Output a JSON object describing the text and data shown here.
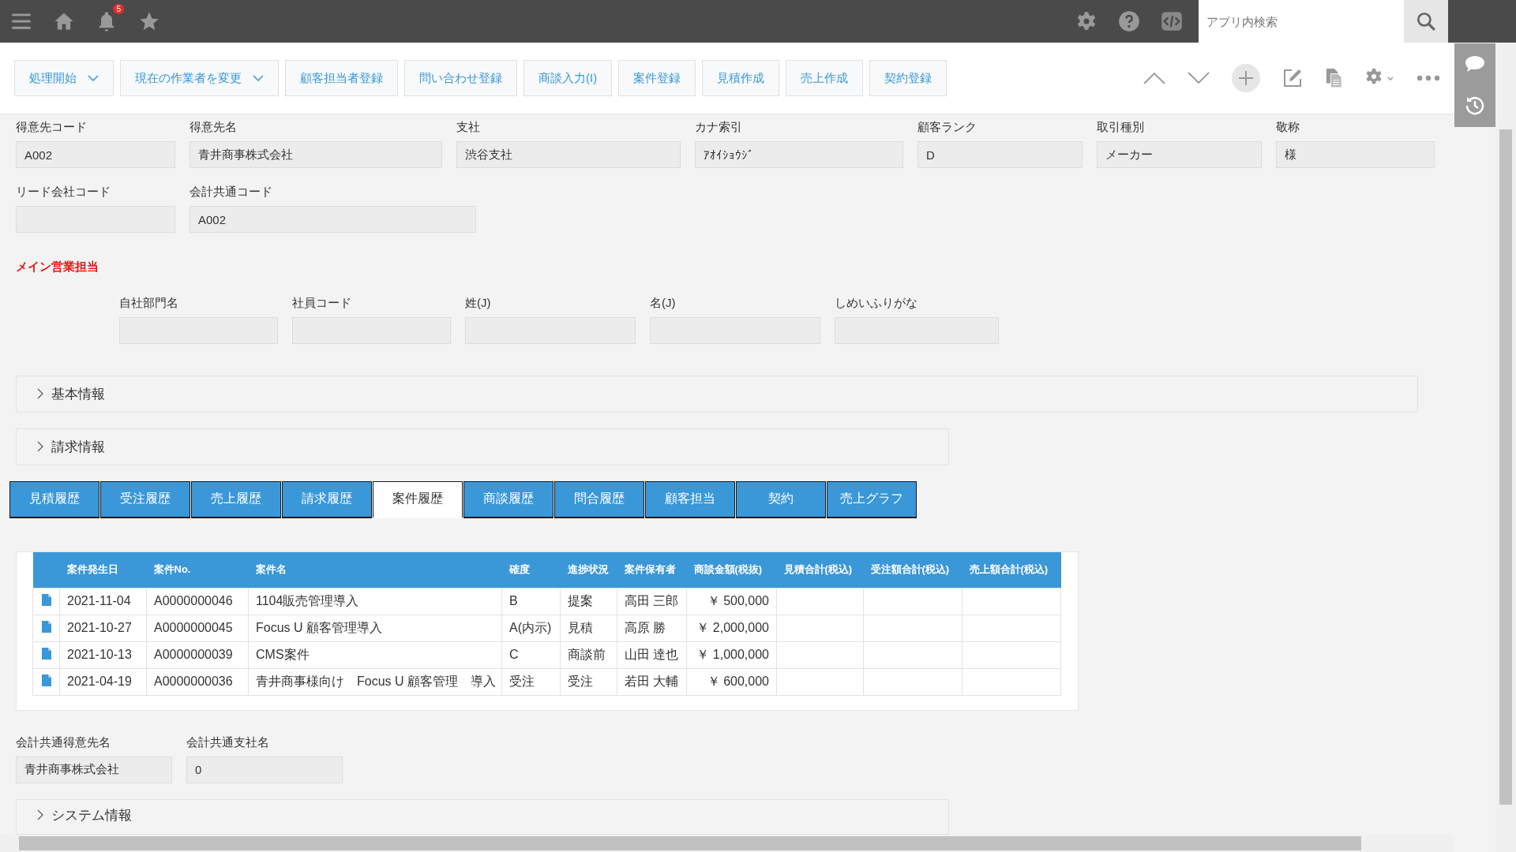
{
  "top_bar": {
    "notification_count": "5",
    "search": {
      "placeholder": "アプリ内検索"
    }
  },
  "toolbar": {
    "buttons": [
      {
        "label": "処理開始",
        "has_menu": true
      },
      {
        "label": "現在の作業者を変更",
        "has_menu": true
      },
      {
        "label": "顧客担当者登録",
        "has_menu": false
      },
      {
        "label": "問い合わせ登録",
        "has_menu": false
      },
      {
        "label": "商談入力(I)",
        "has_menu": false
      },
      {
        "label": "案件登録",
        "has_menu": false
      },
      {
        "label": "見積作成",
        "has_menu": false
      },
      {
        "label": "売上作成",
        "has_menu": false
      },
      {
        "label": "契約登録",
        "has_menu": false
      }
    ]
  },
  "field_rows": [
    [
      {
        "label": "得意先コード",
        "value": "A002"
      },
      {
        "label": "得意先名",
        "value": "青井商事株式会社"
      },
      {
        "label": "支社",
        "value": "渋谷支社"
      },
      {
        "label": "カナ索引",
        "value": "ｱｵｲｼｮｳｼﾞ"
      },
      {
        "label": "顧客ランク",
        "value": "D"
      },
      {
        "label": "取引種別",
        "value": "メーカー"
      },
      {
        "label": "敬称",
        "value": "様"
      }
    ],
    [
      {
        "label": "リード会社コード"
      },
      {
        "label": "会計共通コード",
        "value": "A002"
      }
    ]
  ],
  "main_sales": {
    "title": "メイン営業担当",
    "fields": [
      {
        "label": "自社部門名"
      },
      {
        "label": "社員コード"
      },
      {
        "label": "姓(J)"
      },
      {
        "label": "名(J)"
      },
      {
        "label": "しめいふりがな"
      }
    ]
  },
  "sections": [
    {
      "title": "基本情報",
      "expanded": false
    },
    {
      "title": "請求情報",
      "expanded": false
    }
  ],
  "tabs": [
    {
      "label": "見積履歴",
      "selected": false
    },
    {
      "label": "受注履歴",
      "selected": false
    },
    {
      "label": "売上履歴",
      "selected": false
    },
    {
      "label": "請求履歴",
      "selected": false
    },
    {
      "label": "案件履歴",
      "selected": true
    },
    {
      "label": "商談履歴",
      "selected": false
    },
    {
      "label": "問合履歴",
      "selected": false
    },
    {
      "label": "顧客担当",
      "selected": false
    },
    {
      "label": "契約",
      "selected": false
    },
    {
      "label": "売上グラフ",
      "selected": false
    }
  ],
  "table": {
    "columns": [
      "案件発生日",
      "案件No.",
      "案件名",
      "確度",
      "進捗状況",
      "案件保有者",
      "商談金額(税抜)",
      "見積合計(税込)",
      "受注額合計(税込)",
      "売上額合計(税込)"
    ],
    "rows": [
      [
        "2021-11-04",
        "A0000000046",
        "1104販売管理導入",
        "B",
        "提案",
        "高田 三郎",
        "￥ 500,000"
      ],
      [
        "2021-10-27",
        "A0000000045",
        "Focus U 顧客管理導入",
        "A(内示)",
        "見積",
        "高原 勝",
        "￥ 2,000,000"
      ],
      [
        "2021-10-13",
        "A0000000039",
        "CMS案件",
        "C",
        "商談前",
        "山田 達也",
        "￥ 1,000,000"
      ],
      [
        "2021-04-19",
        "A0000000036",
        "青井商事様向け　Focus U 顧客管理　導入",
        "受注",
        "受注",
        "若田 大輔",
        "￥ 600,000"
      ]
    ]
  },
  "bottom_fields": [
    {
      "label": "会計共通得意先名",
      "value": "青井商事株式会社"
    },
    {
      "label": "会計共通支社名",
      "value": "0"
    }
  ],
  "system_section": {
    "title": "システム情報",
    "expanded": false
  }
}
